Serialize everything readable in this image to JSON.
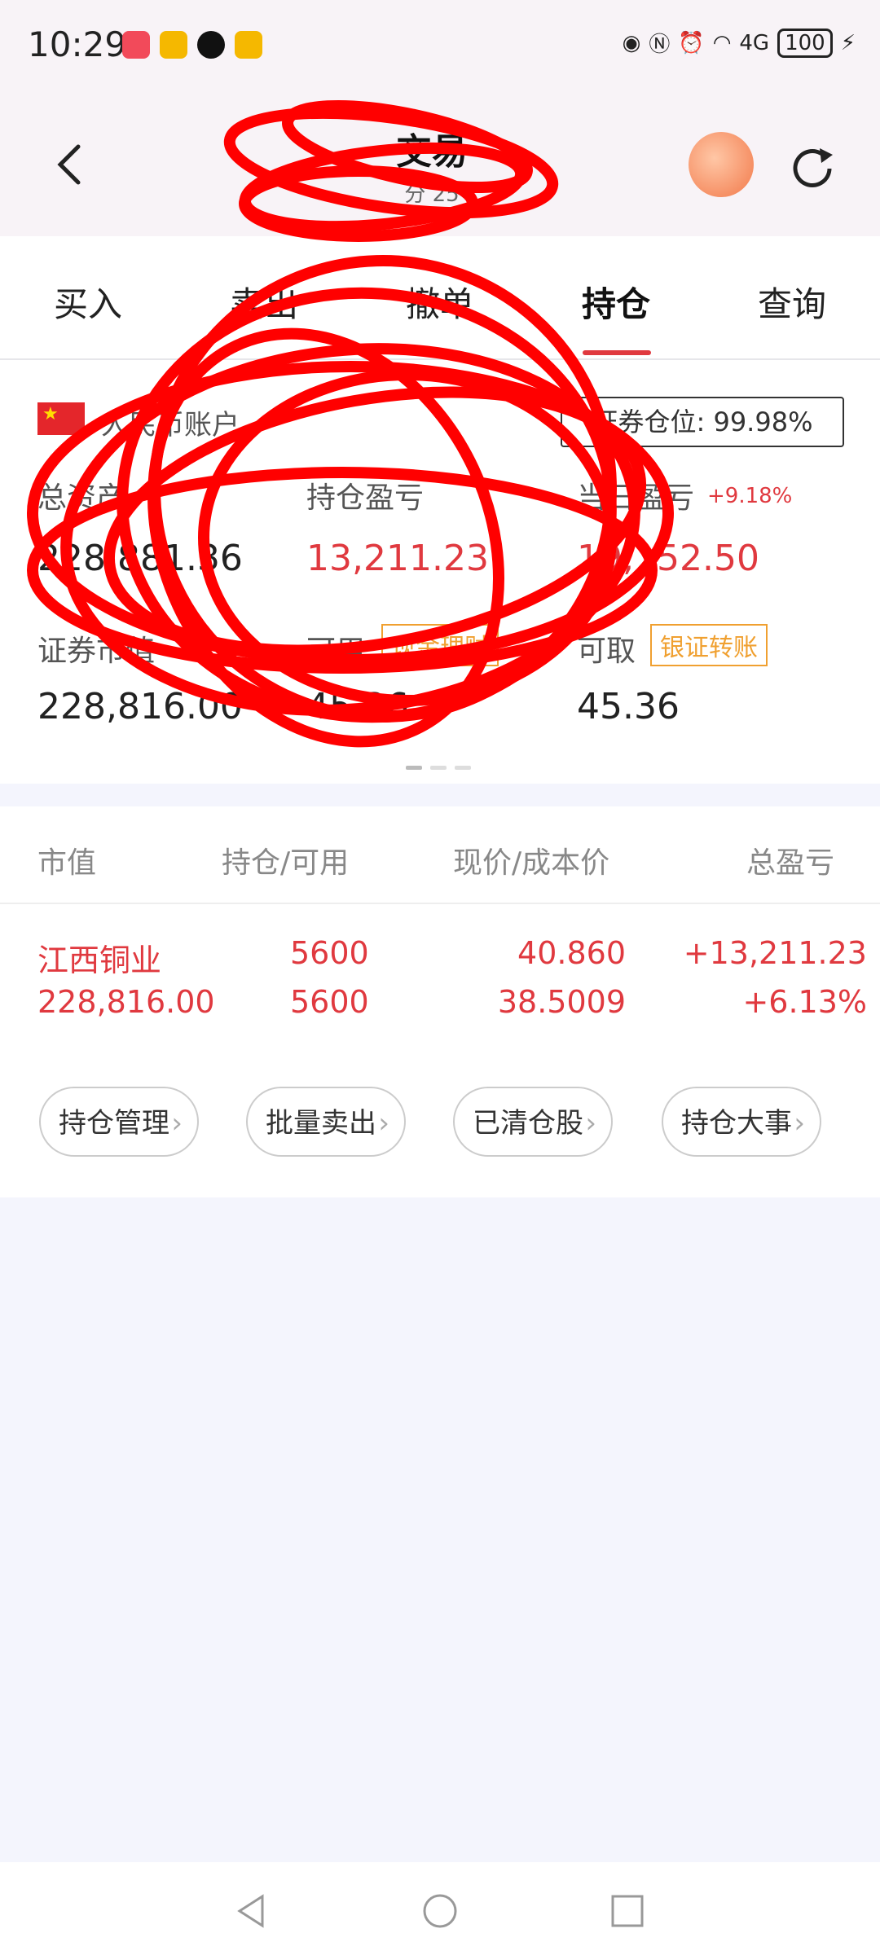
{
  "status_bar": {
    "time": "10:29",
    "battery": "100",
    "signal": "4G"
  },
  "header": {
    "title_visible": "交易",
    "subtitle_visible": "分 25"
  },
  "tabs": [
    {
      "label": "买入"
    },
    {
      "label": "卖出"
    },
    {
      "label": "撤单"
    },
    {
      "label": "持仓"
    },
    {
      "label": "查询"
    }
  ],
  "account": {
    "currency_label": "人民币账户",
    "position_ratio": "证券仓位: 99.98%",
    "total_assets_label": "总资产",
    "total_assets_value": "228,881.36",
    "holding_pnl_label": "持仓盈亏",
    "holding_pnl_value": "13,211.23",
    "today_pnl_label": "当日盈亏",
    "today_pnl_pct": "+9.18%",
    "today_pnl_value": "19,152.50",
    "market_value_label": "证券市值",
    "market_value_value": "228,816.00",
    "available_label": "可用",
    "wealth_tag": "现金理财",
    "withdrawable_label": "可取",
    "transfer_tag": "银证转账",
    "available_value": "45.36",
    "withdrawable_value": "45.36"
  },
  "holdings": {
    "headers": {
      "market_value": "市值",
      "position": "持仓/可用",
      "price": "现价/成本价",
      "total_pnl": "总盈亏"
    },
    "rows": [
      {
        "name": "江西铜业",
        "market_value": "228,816.00",
        "position": "5600",
        "available": "5600",
        "price": "40.860",
        "cost": "38.5009",
        "pnl": "+13,211.23",
        "pnl_pct": "+6.13%"
      }
    ],
    "actions": [
      {
        "label": "持仓管理"
      },
      {
        "label": "批量卖出"
      },
      {
        "label": "已清仓股"
      },
      {
        "label": "持仓大事"
      }
    ]
  },
  "colors": {
    "accent_red": "#e0393f",
    "orange": "#f0a030",
    "scribble": "#ff0000"
  }
}
